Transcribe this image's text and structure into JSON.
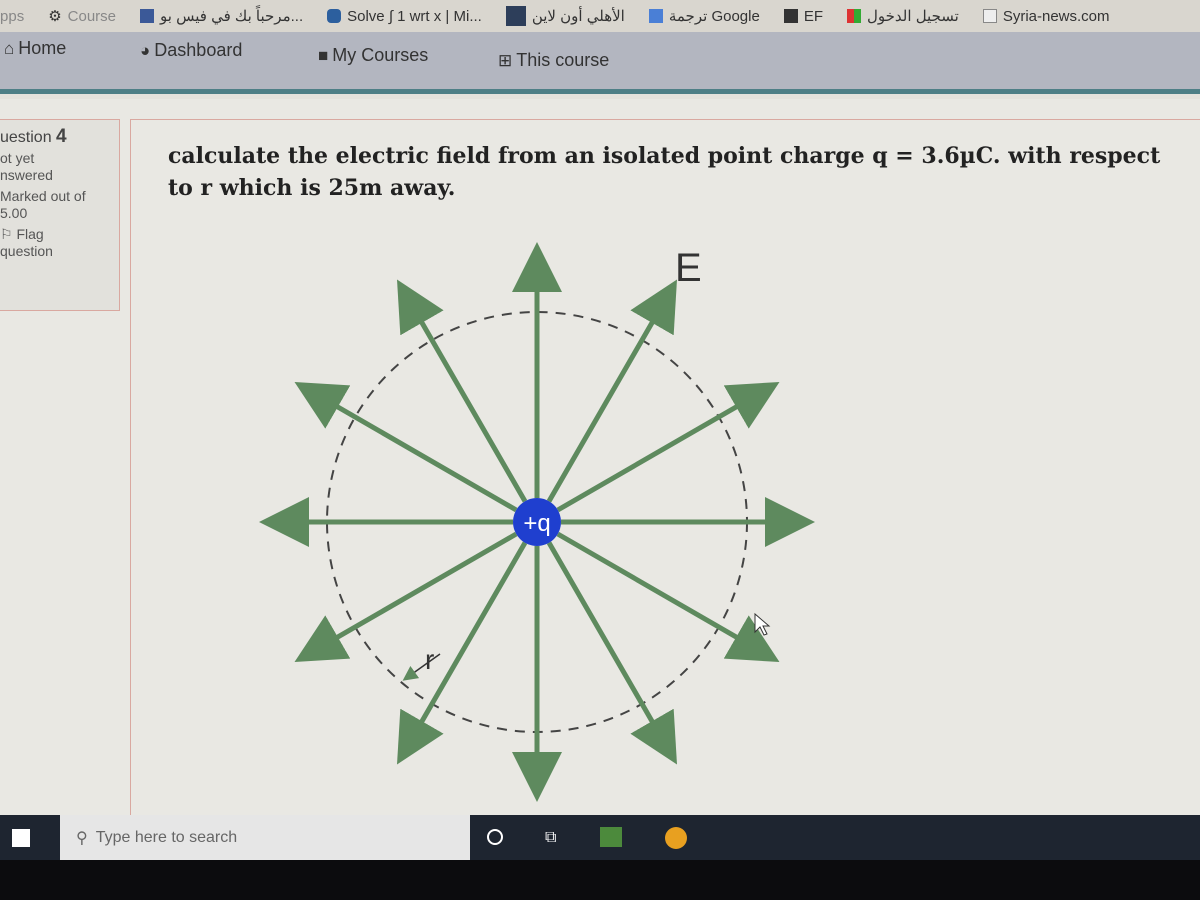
{
  "bookmarks": [
    {
      "label": "Apps",
      "icon": "apps-icon"
    },
    {
      "label": "Course",
      "icon": "gear-icon"
    },
    {
      "label": "مرحباً بك في فيس بو...",
      "icon": "facebook-icon"
    },
    {
      "label": "Solve ∫ 1 wrt x | Mi...",
      "icon": "microsoft-math-icon"
    },
    {
      "label": "الأهلي أون لاين",
      "icon": "site-icon"
    },
    {
      "label": "ترجمة Google",
      "icon": "google-translate-icon"
    },
    {
      "label": "EF",
      "icon": "ef-icon"
    },
    {
      "label": "تسجيل الدخول",
      "icon": "microsoft-icon"
    },
    {
      "label": "Syria-news.com",
      "icon": "page-icon"
    }
  ],
  "nav": {
    "home": "Home",
    "dashboard": "Dashboard",
    "my_courses": "My Courses",
    "this_course": "This course"
  },
  "question_info": {
    "number_label": "uestion",
    "number": "4",
    "status_1": "ot yet",
    "status_2": "nswered",
    "marked_1": "Marked out of",
    "marked_2": "5.00",
    "flag_1": "Flag",
    "flag_2": "question"
  },
  "question": {
    "line1": "calculate the electric field from an isolated point charge q = 3.6µC. with respect",
    "line2": "to r which is 25m away."
  },
  "diagram": {
    "charge_label": "+q",
    "field_label": "E",
    "radius_label": "r",
    "arrow_color": "#5e8a5e",
    "charge_color": "#1f3fcf"
  },
  "taskbar": {
    "search_placeholder": "Type here to search"
  }
}
